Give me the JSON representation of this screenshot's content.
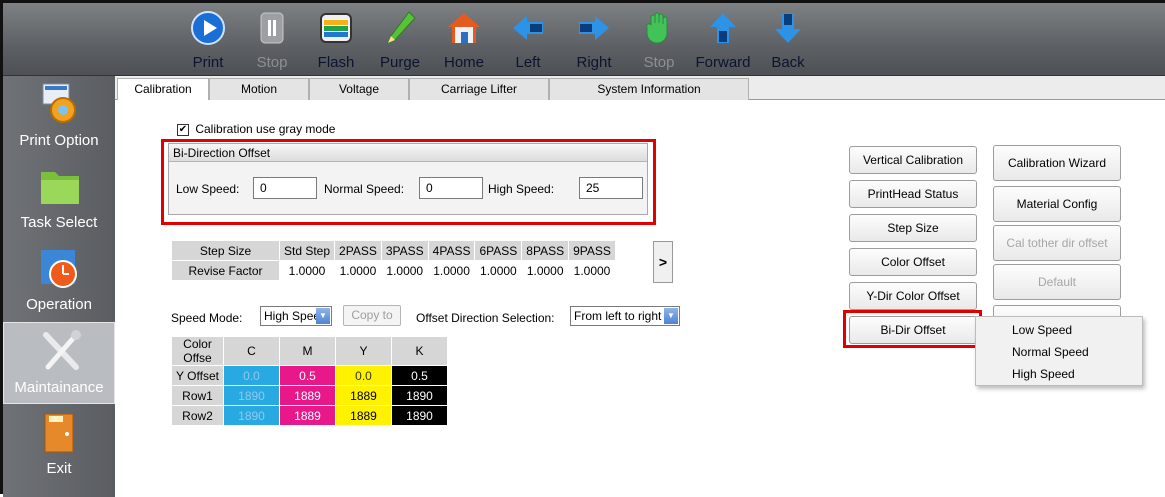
{
  "toolbar": {
    "print": "Print",
    "stop": "Stop",
    "flash": "Flash",
    "purge": "Purge",
    "home": "Home",
    "left": "Left",
    "right": "Right",
    "stop2": "Stop",
    "forward": "Forward",
    "back": "Back"
  },
  "sidebar": {
    "print_option": "Print Option",
    "task_select": "Task Select",
    "operation": "Operation",
    "maintainance": "Maintainance",
    "exit": "Exit"
  },
  "tabs": [
    "Calibration",
    "Motion",
    "Voltage",
    "Carriage Lifter",
    "System Information"
  ],
  "calibration": {
    "gray_mode_label": "Calibration use gray mode",
    "gray_mode_checked": "✔",
    "bidir": {
      "title": "Bi-Direction Offset",
      "low_label": "Low Speed:",
      "low_value": "0",
      "normal_label": "Normal Speed:",
      "normal_value": "0",
      "high_label": "High Speed:",
      "high_value": "25"
    },
    "step_table": {
      "headers": [
        "Step Size",
        "Std Step",
        "2PASS",
        "3PASS",
        "4PASS",
        "6PASS",
        "8PASS",
        "9PASS"
      ],
      "row_label": "Revise Factor",
      "values": [
        "1.0000",
        "1.0000",
        "1.0000",
        "1.0000",
        "1.0000",
        "1.0000",
        "1.0000"
      ],
      "next": ">"
    },
    "speed_mode_label": "Speed Mode:",
    "speed_mode_value": "High Spee",
    "copy_to": "Copy to",
    "offset_dir_label": "Offset Direction Selection:",
    "offset_dir_value": "From left to right",
    "color_table": {
      "headers": [
        "Color Offse",
        "C",
        "M",
        "Y",
        "K"
      ],
      "rows": [
        {
          "label": "Y Offset",
          "c": "0.0",
          "m": "0.5",
          "y": "0.0",
          "k": "0.5"
        },
        {
          "label": "Row1",
          "c": "1890",
          "m": "1889",
          "y": "1889",
          "k": "1890"
        },
        {
          "label": "Row2",
          "c": "1890",
          "m": "1889",
          "y": "1889",
          "k": "1890"
        }
      ]
    }
  },
  "buttons": {
    "vertical_calibration": "Vertical Calibration",
    "printhead_status": "PrintHead Status",
    "step_size": "Step Size",
    "color_offset": "Color Offset",
    "ydir_color_offset": "Y-Dir Color Offset",
    "bidir_offset": "Bi-Dir Offset",
    "calibration_wizard": "Calibration Wizard",
    "material_config": "Material Config",
    "cal_other_dir_offset": "Cal tother dir offset",
    "default": "Default"
  },
  "popup_menu": [
    "Low Speed",
    "Normal Speed",
    "High Speed"
  ],
  "colors": {
    "cyan": "#29a9e1",
    "magenta": "#e8178a",
    "yellow": "#fff200",
    "black": "#000000",
    "highlight": "#e00000"
  }
}
